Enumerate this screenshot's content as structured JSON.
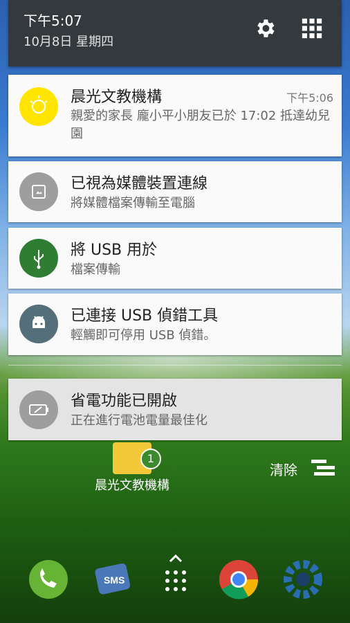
{
  "status": {
    "time": "下午5:07",
    "date": "10月8日 星期四"
  },
  "notifications": [
    {
      "title": "晨光文教機構",
      "time": "下午5:06",
      "body": "親愛的家長 龐小平小朋友已於 17:02 抵達幼兒園",
      "icon": "sun-icon",
      "color": "#ffe500"
    },
    {
      "title": "已視為媒體裝置連線",
      "body": "將媒體檔案傳輸至電腦",
      "icon": "media-device-icon",
      "color": "#9e9e9e"
    },
    {
      "title": "將 USB 用於",
      "body": "檔案傳輸",
      "icon": "usb-icon",
      "color": "#2e7d32"
    },
    {
      "title": "已連接 USB 偵錯工具",
      "body": "輕觸即可停用 USB 偵錯。",
      "icon": "android-icon",
      "color": "#546e7a"
    },
    {
      "title": "省電功能已開啟",
      "body": "正在進行電池電量最佳化",
      "icon": "battery-saver-icon",
      "color": "#9e9e9e"
    }
  ],
  "clear_label": "清除",
  "home": {
    "app_label": "晨光文教機構",
    "badge": "1"
  }
}
